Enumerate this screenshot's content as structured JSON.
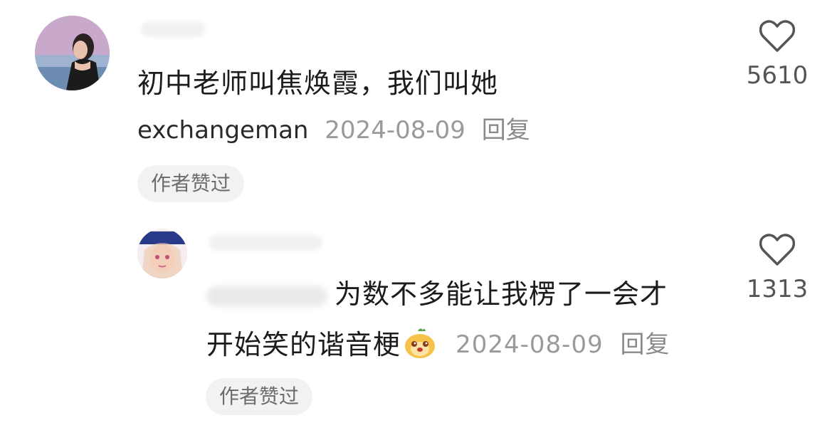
{
  "comments": [
    {
      "text": "初中老师叫焦焕霞，我们叫她",
      "mention": "exchangeman",
      "date": "2024-08-09",
      "reply_label": "回复",
      "badge": "作者赞过",
      "likes": "5610",
      "like_icon": "heart-outline-icon"
    },
    {
      "text_line1": "为数不多能让我楞了一会才",
      "text_line2": "开始笑的谐音梗",
      "emoji": "smiling-face-emoji",
      "date": "2024-08-09",
      "reply_label": "回复",
      "badge": "作者赞过",
      "likes": "1313",
      "like_icon": "heart-outline-icon"
    }
  ],
  "colors": {
    "text": "#1c1c1c",
    "meta": "#9a9a9a",
    "badge_bg": "#f2f2f2"
  }
}
